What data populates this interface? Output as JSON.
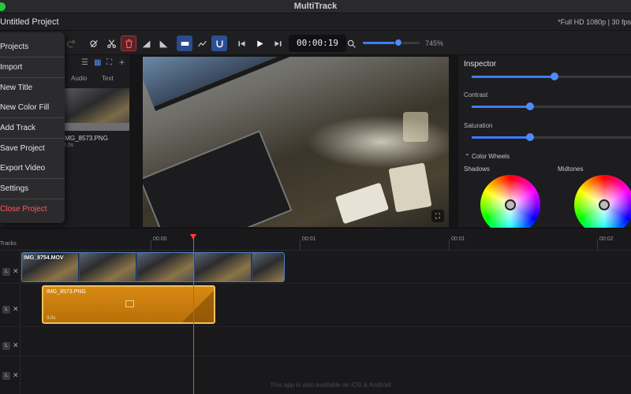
{
  "window": {
    "app_title": "MultiTrack",
    "project_name": "Untitled Project",
    "format_info": "*Full HD 1080p | 30 fps"
  },
  "toolbar": {
    "timecode": "00:00:19",
    "zoom_label": "745%",
    "zoom_fraction": 0.62
  },
  "menu": {
    "items": [
      {
        "label": "Projects"
      },
      {
        "label": "Import"
      },
      {
        "label": "New Title"
      },
      {
        "label": "New Color Fill"
      },
      {
        "label": "Add Track"
      },
      {
        "label": "Save Project"
      },
      {
        "label": "Export Video"
      },
      {
        "label": "Settings"
      },
      {
        "label": "Close Project"
      }
    ]
  },
  "media": {
    "tabs": [
      "Audio",
      "Text"
    ],
    "file_name": "IMG_8573.PNG",
    "file_duration": "3.0s"
  },
  "inspector": {
    "title": "Inspector",
    "brightness_fraction": 0.5,
    "contrast_label": "Contrast",
    "contrast_fraction": 0.35,
    "saturation_label": "Saturation",
    "saturation_fraction": 0.35,
    "color_wheels_label": "Color Wheels",
    "shadows_label": "Shadows",
    "midtones_label": "Midtones"
  },
  "timeline": {
    "tracks_label": "Tracks",
    "ruler_labels": [
      "00:00",
      "00:01",
      "00:01",
      "00:02"
    ],
    "video_clip_name": "IMG_8754.MOV",
    "image_clip_name": "IMG_8573.PNG",
    "image_clip_duration": "3.0s",
    "lock_label": "L",
    "remove_label": "✕"
  },
  "footer": {
    "note": "This app is also available on iOS & Android"
  },
  "colors": {
    "accent": "#3d7bff",
    "danger": "#ff5a5a",
    "playhead": "#ff3b3b",
    "image_clip": "#d88a12"
  }
}
